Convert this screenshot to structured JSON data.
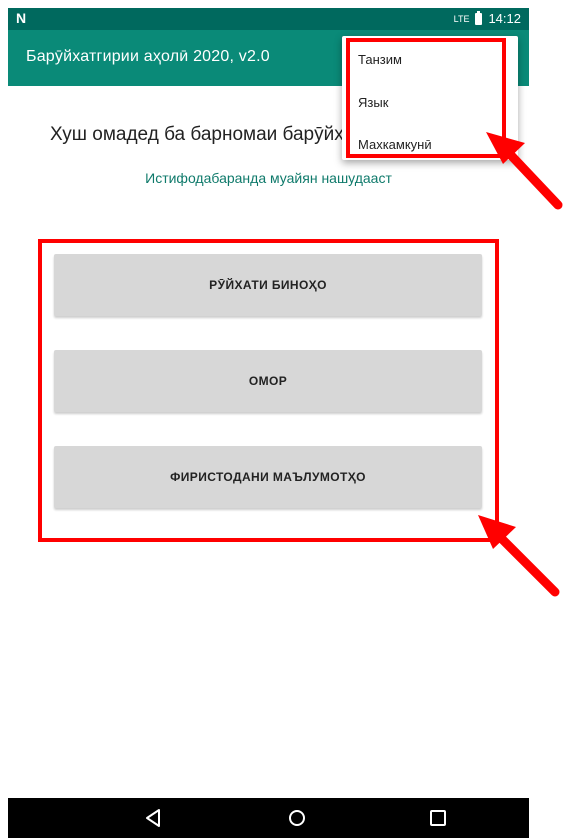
{
  "status_bar": {
    "notification_icon": "N",
    "network": "LTE",
    "time": "14:12"
  },
  "app_bar": {
    "title": "Барӯйхатгирии аҳолӣ 2020, v2.0"
  },
  "main": {
    "welcome_text": "Хуш омадед ба барномаи барӯйх",
    "user_status": "Истифодабаранда муайян нашудааст",
    "buttons": [
      {
        "label": "РӮЙХАТИ БИНОҲО"
      },
      {
        "label": "ОМОР"
      },
      {
        "label": "ФИРИСТОДАНИ МАЪЛУМОТҲО"
      }
    ]
  },
  "overflow_menu": {
    "items": [
      {
        "label": "Танзим"
      },
      {
        "label": "Язык"
      },
      {
        "label": "Махкамкунӣ"
      }
    ]
  },
  "annotations": {
    "highlight_color": "#ff0000"
  },
  "nav_bar": {
    "icons": [
      "back-icon",
      "home-icon",
      "recents-icon"
    ]
  },
  "colors": {
    "status_bar": "#00695e",
    "app_bar": "#0a8a78",
    "accent_text": "#0f7a6b",
    "button_bg": "#d7d7d7"
  }
}
